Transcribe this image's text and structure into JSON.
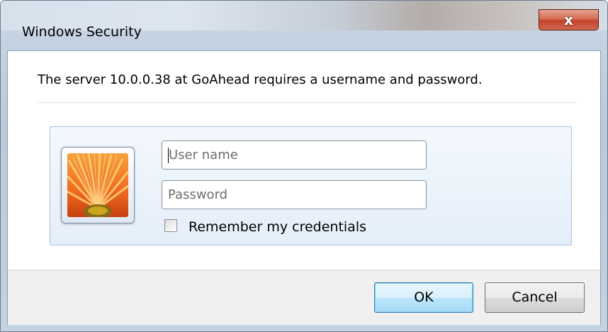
{
  "window": {
    "title": "Windows Security",
    "close_glyph": "x"
  },
  "message": "The server 10.0.0.38 at GoAhead requires a username and password.",
  "credentials": {
    "avatar_icon": "user-picture-flower-icon",
    "username": {
      "placeholder": "User name",
      "value": ""
    },
    "password": {
      "placeholder": "Password",
      "value": ""
    },
    "remember": {
      "label": "Remember my credentials",
      "checked": false
    }
  },
  "buttons": {
    "ok_label": "OK",
    "cancel_label": "Cancel"
  },
  "colors": {
    "close_button": "#c7452c",
    "ok_button_border": "#3c7fb1",
    "panel_background": "#e4eef9"
  }
}
